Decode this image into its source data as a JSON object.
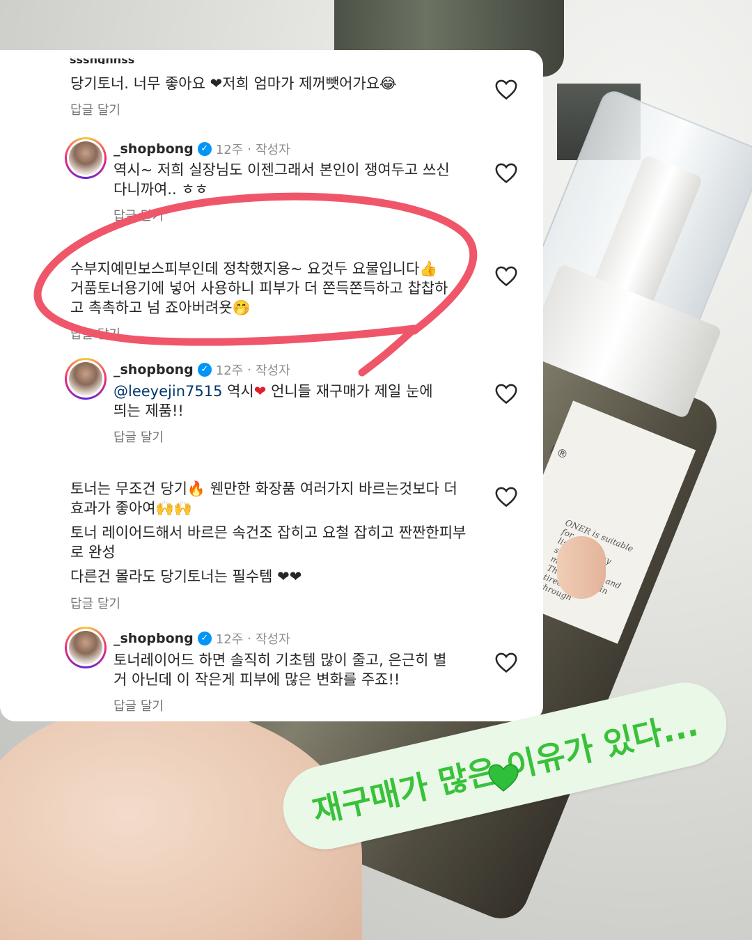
{
  "comments": [
    {
      "text_lines": [
        "당기토너. 너무 좋아요 ❤저희 엄마가 제꺼뺏어가요😂"
      ],
      "reply_label": "답글 달기"
    },
    {
      "username": "_shopbong",
      "time": "12주",
      "author_badge": "작성자",
      "text_lines": [
        "역시~ 저희 실장님도 이젠그래서 본인이 쟁여두고 쓰신",
        "다니까여.. ㅎㅎ"
      ],
      "reply_label": "답글 달기"
    },
    {
      "text_lines": [
        "수부지예민보스피부인데 정착했지용~ 요것두 요물입니다👍",
        "거품토너용기에 넣어 사용하니 피부가 더 쫀득쫀득하고 찹찹하",
        "고 촉촉하고 넘 죠아버려욧🤭"
      ],
      "reply_label": "답글 달기"
    },
    {
      "username": "_shopbong",
      "time": "12주",
      "author_badge": "작성자",
      "mention": "@leeyejin7515",
      "text_after_mention": " 역시",
      "text_after_heart": " 언니들 재구매가 제일 눈에",
      "text_line2": "띄는 제품!!",
      "reply_label": "답글 달기"
    },
    {
      "paragraphs": [
        "토너는 무조건 당기🔥 웬만한 화장품 여러가지 바르는것보다 더 효과가 좋아여🙌🙌",
        "토너 레이어드해서 바르믄 속건조 잡히고 요철 잡히고 짠짠한피부로 완성",
        "다른건 몰라도 당기토너는 필수템 ❤❤"
      ],
      "reply_label": "답글 달기"
    },
    {
      "username": "_shopbong",
      "time": "12주",
      "author_badge": "작성자",
      "text_lines": [
        "토너레이어드 하면 솔직히 기초템 많이 줄고, 은근히 별",
        "거 아닌데 이 작은게 피부에 많은 변화를 주죠!!"
      ],
      "reply_label": "답글 달기"
    }
  ],
  "sticker": {
    "text": "재구매가 많은 이유가 있다...",
    "color": "#39c13a",
    "icon": "green-heart-icon"
  },
  "colors": {
    "highlight": "#f0566a",
    "mention": "#00376b",
    "verified": "#0095f6"
  }
}
